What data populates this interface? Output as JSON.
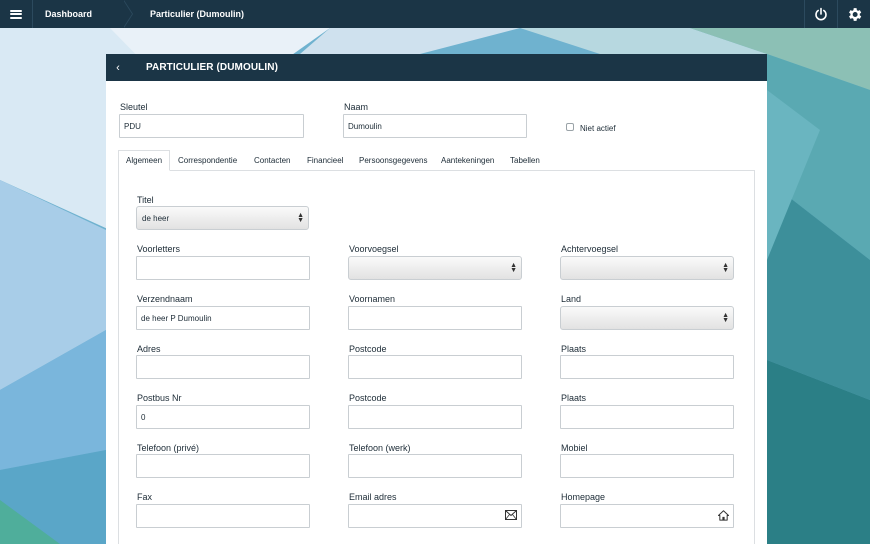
{
  "topbar": {
    "breadcrumb_1": "Dashboard",
    "breadcrumb_2": "Particulier (Dumoulin)"
  },
  "panel": {
    "title": "PARTICULIER (DUMOULIN)"
  },
  "header_fields": {
    "sleutel": {
      "label": "Sleutel",
      "value": "PDU"
    },
    "naam": {
      "label": "Naam",
      "value": "Dumoulin"
    },
    "niet_actief": {
      "label": "Niet actief",
      "checked": false
    }
  },
  "tabs": [
    "Algemeen",
    "Correspondentie",
    "Contacten",
    "Financieel",
    "Persoonsgegevens",
    "Aantekeningen",
    "Tabellen"
  ],
  "form": {
    "titel": {
      "label": "Titel",
      "value": "de heer"
    },
    "voorletters": {
      "label": "Voorletters",
      "value": ""
    },
    "voorvoegsel": {
      "label": "Voorvoegsel",
      "value": ""
    },
    "achtervoegsel": {
      "label": "Achtervoegsel",
      "value": ""
    },
    "verzendnaam": {
      "label": "Verzendnaam",
      "value": "de heer P Dumoulin"
    },
    "voornamen": {
      "label": "Voornamen",
      "value": ""
    },
    "land": {
      "label": "Land",
      "value": ""
    },
    "adres": {
      "label": "Adres",
      "value": ""
    },
    "postcode1": {
      "label": "Postcode",
      "value": ""
    },
    "plaats1": {
      "label": "Plaats",
      "value": ""
    },
    "postbus": {
      "label": "Postbus Nr",
      "value": "0"
    },
    "postcode2": {
      "label": "Postcode",
      "value": ""
    },
    "plaats2": {
      "label": "Plaats",
      "value": ""
    },
    "tel_prive": {
      "label": "Telefoon (privé)",
      "value": ""
    },
    "tel_werk": {
      "label": "Telefoon (werk)",
      "value": ""
    },
    "mobiel": {
      "label": "Mobiel",
      "value": ""
    },
    "fax": {
      "label": "Fax",
      "value": ""
    },
    "email": {
      "label": "Email adres",
      "value": ""
    },
    "homepage": {
      "label": "Homepage",
      "value": ""
    }
  },
  "icons": {
    "menu": "hamburger-icon",
    "power": "power-icon",
    "settings": "gear-icon",
    "back": "chevron-left-icon",
    "email": "envelope-icon",
    "homepage": "home-icon"
  },
  "colors": {
    "topbar": "#1b3546",
    "panel_header": "#1b3546"
  }
}
